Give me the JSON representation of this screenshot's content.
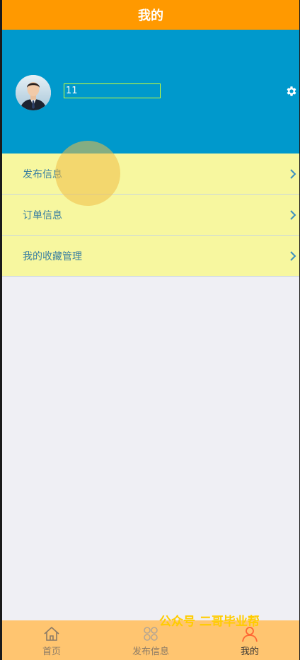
{
  "header": {
    "title": "我的"
  },
  "profile": {
    "username": "11",
    "avatar_icon": "user-avatar-photo",
    "settings_icon": "gear-icon"
  },
  "menu": {
    "items": [
      {
        "label": "发布信息",
        "icon": "chevron-right-icon"
      },
      {
        "label": "订单信息",
        "icon": "chevron-right-icon"
      },
      {
        "label": "我的收藏管理",
        "icon": "chevron-right-icon"
      }
    ]
  },
  "tabbar": {
    "items": [
      {
        "label": "首页",
        "icon": "home-icon",
        "active": false
      },
      {
        "label": "发布信息",
        "icon": "grid-icon",
        "active": false
      },
      {
        "label": "我的",
        "icon": "person-icon",
        "active": true
      }
    ]
  },
  "watermark": {
    "text": "公众号 二哥毕业帮"
  },
  "colors": {
    "title_bar": "#ff9900",
    "profile_bg": "#0099cc",
    "menu_bg": "#f7f79f",
    "page_bg": "#efeff4",
    "tabbar_bg": "#ffc570",
    "active_tab_icon": "#ff6633",
    "watermark": "#ffcc00"
  }
}
